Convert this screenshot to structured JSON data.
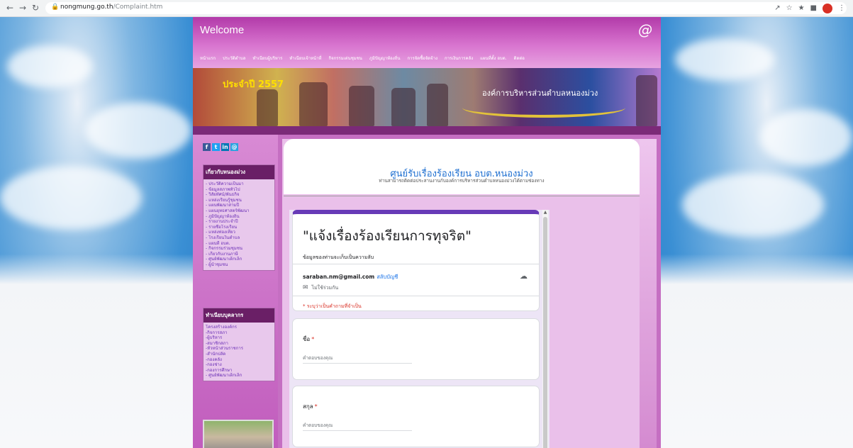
{
  "browser": {
    "url_host": "nongmung.go.th",
    "url_path": "/Complaint.htm",
    "back_icon": "arrow-left",
    "forward_icon": "arrow-right",
    "reload_icon": "reload"
  },
  "site": {
    "welcome": "Welcome",
    "logo_glyph": "@",
    "nav": [
      "หน้าแรก",
      "ประวัติตำบล",
      "ทำเนียบผู้บริหาร",
      "ทำเนียบเจ้าหน้าที่",
      "กิจกรรมเด่นชุมชน",
      "ภูมิปัญญาท้องถิ่น",
      "การจัดซื้อจัดจ้าง",
      "การเงินการคลัง",
      "แผนที่ตั้ง อบต.",
      "ติดต่อ"
    ],
    "banner_year": "ประจำปี 2557",
    "banner_org": "องค์การบริหารส่วนตำบลหนองม่วง"
  },
  "sidebar": {
    "social": [
      "f",
      "t",
      "in",
      "@"
    ],
    "about": {
      "heading": "เกี่ยวกับหนองม่วง",
      "items": [
        "- ประวัติความเป็นมา",
        "- ข้อมูลสภาพทั่วไป",
        "- วิสัยทัศน์/พันธกิจ",
        "- แหล่งเรียนรู้ชุมชน",
        "- แผนพัฒนาสามปี",
        "- แผนยุทธศาสตร์พัฒนา",
        "- ภูมิปัญญาท้องถิ่น",
        "- รายงานประจำปี",
        "- รายชื่อโรงเรียน",
        "- แหล่งท่องเที่ยว",
        "- โรงเรียนในตำบล",
        "- แผนที่ อบต.",
        "- กิจกรรมร่วมชุมชน",
        "- เกี่ยวกับงานภาษี",
        "- ศูนย์พัฒนาเด็กเล็ก",
        "- ผู้นำชุมชน"
      ]
    },
    "staff": {
      "heading": "ทำเนียบบุคลากร",
      "items": [
        "โครงสร้างองค์กร",
        "-กิจการสภา",
        "-ผู้บริหาร",
        "-สมาชิกสภา",
        "-หัวหน้าส่วนราชการ",
        "-สำนักปลัด",
        "-กองคลัง",
        "-กองช่าง",
        "-กองการศึกษา",
        "- ศูนย์พัฒนาเด็กเล็ก"
      ]
    }
  },
  "main": {
    "title": "ศูนย์รับเรื่องร้องเรียน อบต.หนองม่วง",
    "subtitle": "ท่านสามารถติดต่อประสานงานกับองค์การบริหารส่วนตำบลหนองม่วงได้ตามช่องทาง"
  },
  "form": {
    "title": "\"แจ้งเรื่องร้องเรียนการทุจริต\"",
    "description": "ข้อมูลของท่านจะเก็บเป็นความลับ",
    "account_email": "saraban.nm@gmail.com",
    "switch_account": "สลับบัญชี",
    "not_shared": "ไม่ใช้ร่วมกัน",
    "required_note": "* ระบุว่าเป็นคำถามที่จำเป็น",
    "questions": [
      {
        "label": "ชื่อ",
        "required_mark": "*",
        "placeholder": "คำตอบของคุณ"
      },
      {
        "label": "สกุล",
        "required_mark": "*",
        "placeholder": "คำตอบของคุณ"
      }
    ],
    "accent_color": "#673ab7"
  }
}
